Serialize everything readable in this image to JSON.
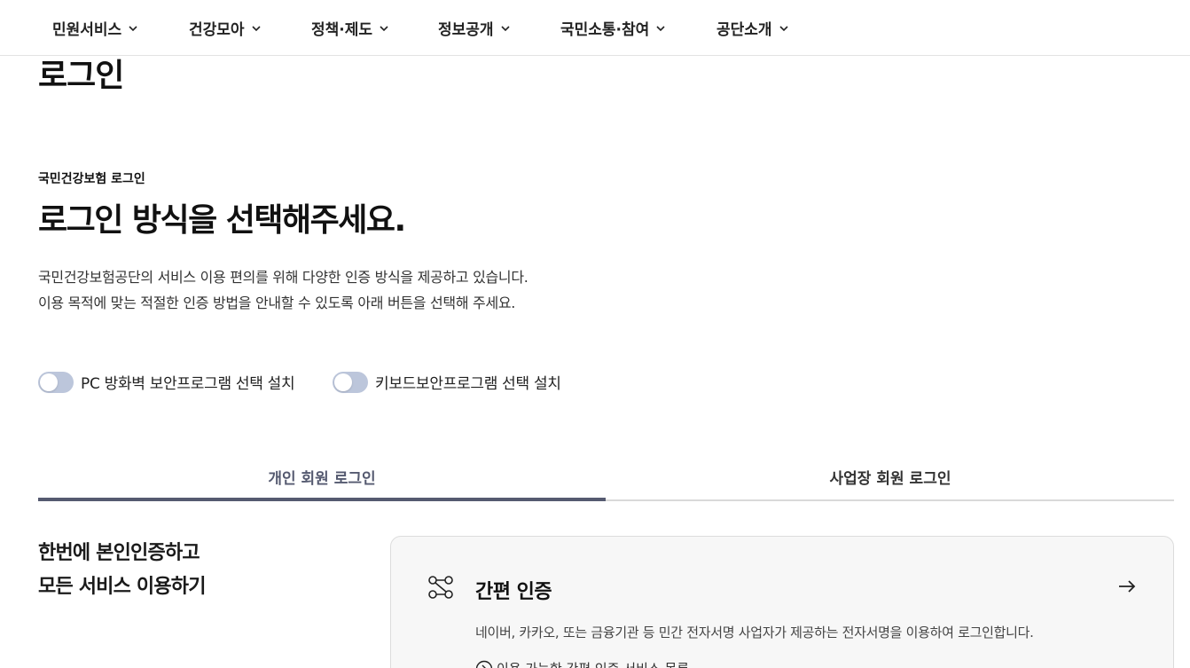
{
  "gnb": {
    "items": [
      {
        "label": "민원서비스",
        "icon": "chevron-down-icon"
      },
      {
        "label": "건강모아",
        "icon": "chevron-down-icon"
      },
      {
        "label": "정책·제도",
        "icon": "chevron-down-icon"
      },
      {
        "label": "정보공개",
        "icon": "chevron-down-icon"
      },
      {
        "label": "국민소통·참여",
        "icon": "chevron-down-icon"
      },
      {
        "label": "공단소개",
        "icon": "chevron-down-icon"
      }
    ]
  },
  "page": {
    "heading": "로그인",
    "eyebrow": "국민건강보험 로그인",
    "title": "로그인 방식을 선택해주세요.",
    "description_line1": "국민건강보험공단의 서비스 이용 편의를 위해 다양한 인증 방식을 제공하고 있습니다.",
    "description_line2": "이용 목적에 맞는 적절한 인증 방법을 안내할 수 있도록 아래 버튼을 선택해 주세요."
  },
  "toggles": [
    {
      "label": "PC 방화벽 보안프로그램 선택 설치",
      "on": false
    },
    {
      "label": "키보드보안프로그램 선택 설치",
      "on": false
    }
  ],
  "tabs": [
    {
      "label": "개인 회원 로그인",
      "active": true
    },
    {
      "label": "사업장 회원 로그인",
      "active": false
    }
  ],
  "promo": {
    "line1": "한번에 본인인증하고",
    "line2": "모든 서비스 이용하기"
  },
  "card": {
    "icon": "simple-auth-icon",
    "title": "간편 인증",
    "arrow_icon": "arrow-right-icon",
    "description": "네이버, 카카오, 또는 금융기관 등 민간 전자서명 사업자가 제공하는 전자서명을 이용하여 로그인합니다.",
    "link_label": "이용 가능한 간편 인증 서비스 목록",
    "link_icon": "circle-chevron-icon"
  },
  "colors": {
    "accent": "#555a70",
    "toggle_off": "#bcc6db",
    "card_bg": "#f7f7f7",
    "divider": "#d9d9d9"
  }
}
